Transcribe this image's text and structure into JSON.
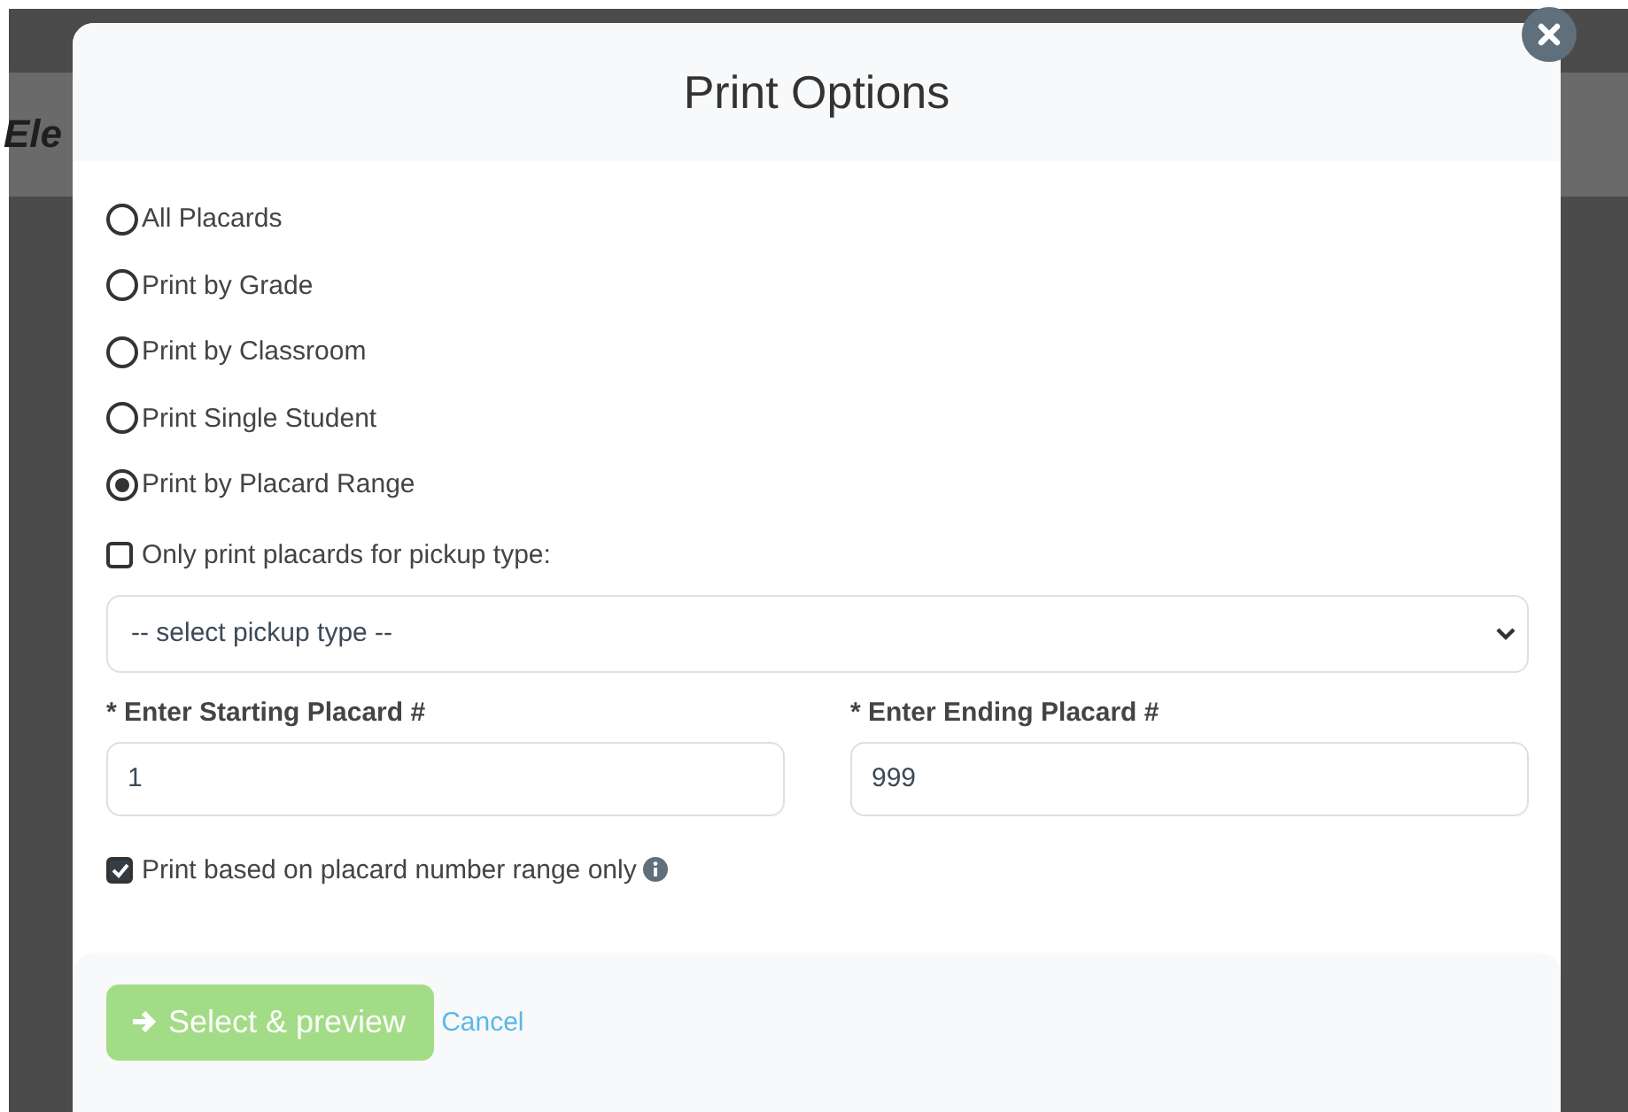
{
  "background": {
    "heading": "Ele"
  },
  "dialog": {
    "title": "Print Options",
    "print_modes": [
      {
        "label": "All Placards",
        "selected": false
      },
      {
        "label": "Print by Grade",
        "selected": false
      },
      {
        "label": "Print by Classroom",
        "selected": false
      },
      {
        "label": "Print Single Student",
        "selected": false
      },
      {
        "label": "Print by Placard Range",
        "selected": true
      }
    ],
    "pickup_filter": {
      "label": "Only print placards for pickup type:",
      "checked": false
    },
    "pickup_select": {
      "value": "-- select pickup type --"
    },
    "start_field": {
      "required_mark": "*",
      "label": "Enter Starting Placard #",
      "value": "1"
    },
    "end_field": {
      "required_mark": "*",
      "label": "Enter Ending Placard #",
      "value": "999"
    },
    "range_only": {
      "label": "Print based on placard number range only",
      "checked": true
    },
    "primary_button": {
      "label": "Select & preview",
      "disabled": true
    },
    "cancel_link": {
      "label": "Cancel"
    }
  }
}
